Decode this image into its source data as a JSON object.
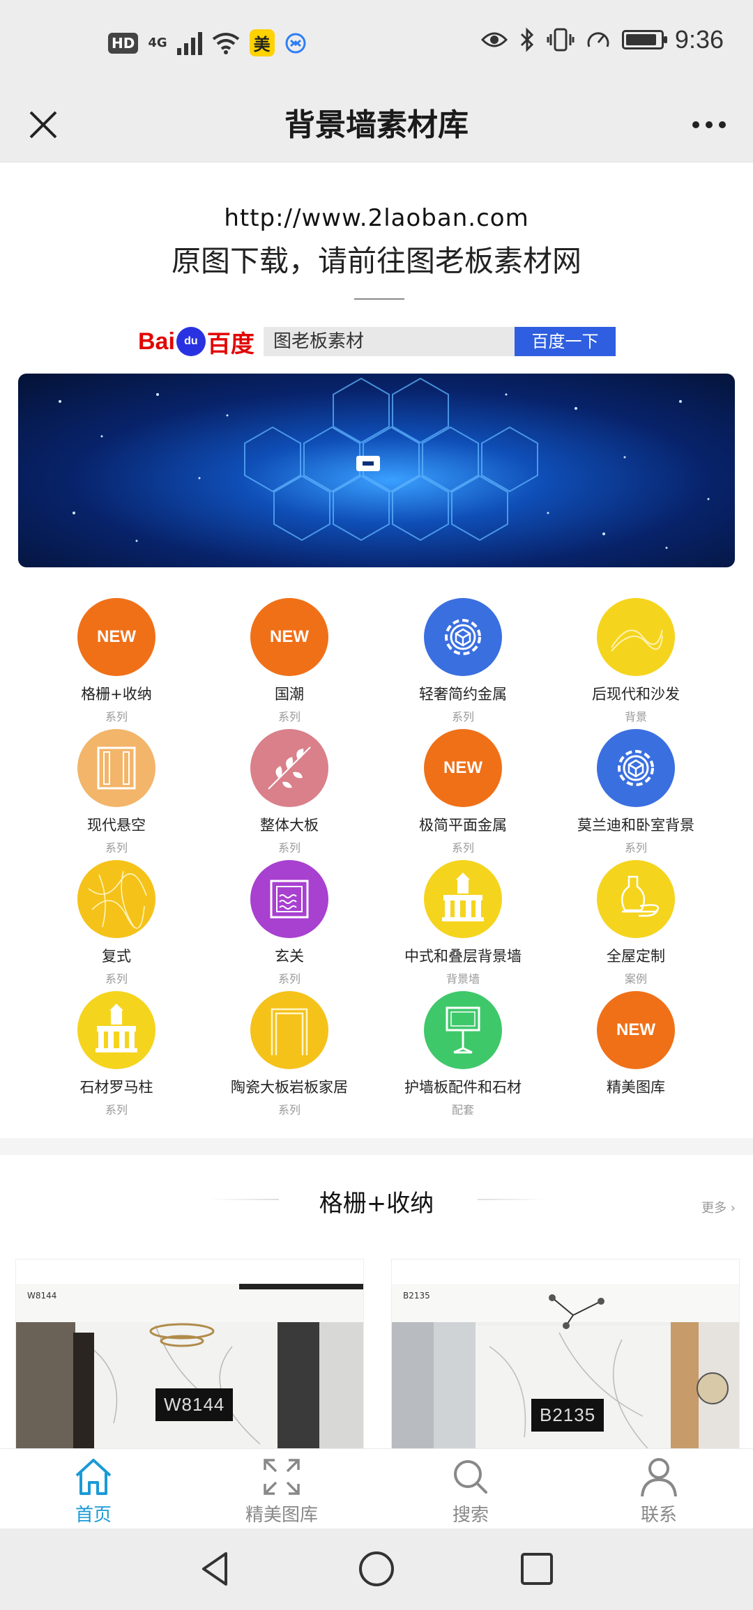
{
  "status_bar": {
    "hd": "HD",
    "network": "4G",
    "app_badge": "美",
    "time": "9:36",
    "battery_level": 0.9,
    "icons": [
      "signal-icon",
      "wifi-icon",
      "eye-icon",
      "bluetooth-icon",
      "vibrate-icon",
      "speed-icon",
      "battery-icon"
    ]
  },
  "titlebar": {
    "title": "背景墙素材库",
    "close_icon": "close-icon",
    "more_icon": "more-icon"
  },
  "header": {
    "url": "http://www.2laoban.com",
    "subtitle": "原图下载，请前往图老板素材网"
  },
  "baidu": {
    "logo_bai": "Bai",
    "logo_du": "du",
    "logo_cn": "百度",
    "query": "图老板素材",
    "button": "百度一下"
  },
  "categories": [
    {
      "name": "格栅+收纳",
      "sub": "系列",
      "color": "#f07018",
      "icon": "new-icon",
      "badge": "NEW"
    },
    {
      "name": "国潮",
      "sub": "系列",
      "color": "#f07018",
      "icon": "new-icon",
      "badge": "NEW"
    },
    {
      "name": "轻奢简约金属",
      "sub": "系列",
      "color": "#3a6fe0",
      "icon": "gear-cube-icon",
      "badge": ""
    },
    {
      "name": "后现代和沙发",
      "sub": "背景",
      "color": "#f5d41e",
      "icon": "curve-icon",
      "badge": ""
    },
    {
      "name": "现代悬空",
      "sub": "系列",
      "color": "#f2b56a",
      "icon": "frame-icon",
      "badge": ""
    },
    {
      "name": "整体大板",
      "sub": "系列",
      "color": "#d9808a",
      "icon": "ginkgo-icon",
      "badge": ""
    },
    {
      "name": "极简平面金属",
      "sub": "系列",
      "color": "#f07018",
      "icon": "new-icon",
      "badge": "NEW"
    },
    {
      "name": "莫兰迪和卧室背景",
      "sub": "系列",
      "color": "#3a6fe0",
      "icon": "gear-cube-icon",
      "badge": ""
    },
    {
      "name": "复式",
      "sub": "系列",
      "color": "#f5c21a",
      "icon": "marble-icon",
      "badge": ""
    },
    {
      "name": "玄关",
      "sub": "系列",
      "color": "#a840d0",
      "icon": "picture-icon",
      "badge": ""
    },
    {
      "name": "中式和叠层背景墙",
      "sub": "背景墙",
      "color": "#f5d41e",
      "icon": "building-icon",
      "badge": ""
    },
    {
      "name": "全屋定制",
      "sub": "案例",
      "color": "#f5d41e",
      "icon": "vase-icon",
      "badge": ""
    },
    {
      "name": "石材罗马柱",
      "sub": "系列",
      "color": "#f5d41e",
      "icon": "building-icon",
      "badge": ""
    },
    {
      "name": "陶瓷大板岩板家居",
      "sub": "系列",
      "color": "#f5c21a",
      "icon": "door-icon",
      "badge": ""
    },
    {
      "name": "护墙板配件和石材",
      "sub": "配套",
      "color": "#3fc86a",
      "icon": "signboard-icon",
      "badge": ""
    },
    {
      "name": "精美图库",
      "sub": "",
      "color": "#f07018",
      "icon": "new-icon",
      "badge": "NEW"
    }
  ],
  "section": {
    "title": "格栅+收纳",
    "more": "更多 ›"
  },
  "products": [
    {
      "code_small": "W8144",
      "code_big": "W8144"
    },
    {
      "code_small": "B2135",
      "code_big": "B2135"
    }
  ],
  "tabbar": [
    {
      "label": "首页",
      "icon": "home-icon",
      "active": true
    },
    {
      "label": "精美图库",
      "icon": "expand-icon",
      "active": false
    },
    {
      "label": "搜索",
      "icon": "search-icon",
      "active": false
    },
    {
      "label": "联系",
      "icon": "user-icon",
      "active": false
    }
  ],
  "colors": {
    "accent": "#1a9ad6",
    "baidu_blue": "#2f5fe0",
    "baidu_red": "#e10602"
  }
}
